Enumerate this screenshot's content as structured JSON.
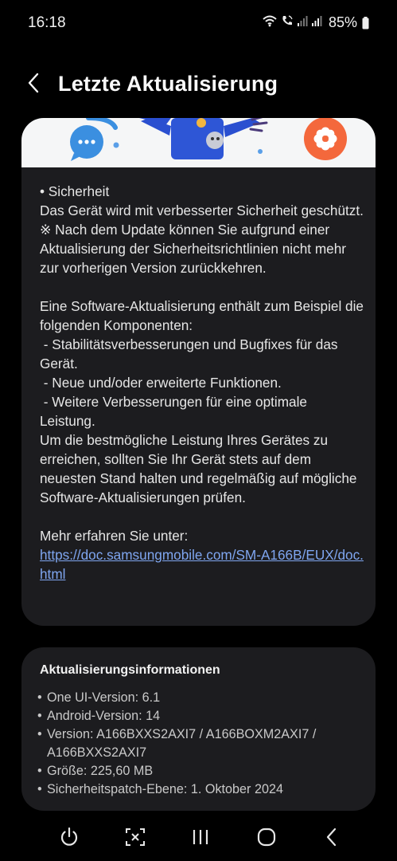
{
  "status_bar": {
    "time": "16:18",
    "battery_percent": "85%"
  },
  "header": {
    "back_icon": "chevron-left-icon",
    "title": "Letzte Aktualisierung"
  },
  "release_notes": {
    "security_heading": "• Sicherheit",
    "security_text": "Das Gerät wird mit verbesserter Sicherheit geschützt.",
    "security_note": "※ Nach dem Update können Sie aufgrund einer Aktualisierung der Sicherheitsrichtlinien nicht mehr zur vorherigen Version zurückkehren.",
    "components_intro": "Eine Software-Aktualisierung enthält zum Beispiel die folgenden Komponenten:",
    "component_1": " - Stabilitätsverbesserungen und Bugfixes für das Gerät.",
    "component_2": " - Neue und/oder erweiterte Funktionen.",
    "component_3": " - Weitere Verbesserungen für eine optimale Leistung.",
    "advice": "Um die bestmögliche Leistung Ihres Gerätes zu erreichen, sollten Sie Ihr Gerät stets auf dem neuesten Stand halten und regelmäßig auf mögliche Software-Aktualisierungen prüfen.",
    "more_info_label": "Mehr erfahren Sie unter:",
    "more_info_link": "https://doc.samsungmobile.com/SM-A166B/EUX/doc.html"
  },
  "update_info": {
    "title": "Aktualisierungsinformationen",
    "items": [
      "One UI-Version: 6.1",
      "Android-Version: 14",
      "Version: A166BXXS2AXI7 / A166BOXM2AXI7 / A166BXXS2AXI7",
      "Größe: 225,60 MB",
      "Sicherheitspatch-Ebene: 1. Oktober 2024"
    ]
  },
  "nav_bar": {
    "icons": [
      "power-icon",
      "screenshot-capture-icon",
      "recent-apps-icon",
      "home-icon",
      "back-icon"
    ]
  },
  "colors": {
    "background": "#000000",
    "card": "#1c1c1f",
    "link": "#7fa6f0",
    "accent_orange": "#f4683c",
    "accent_blue": "#3b8fe0"
  }
}
